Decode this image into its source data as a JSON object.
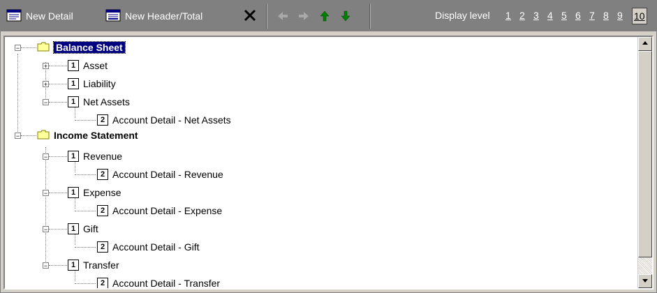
{
  "toolbar": {
    "new_detail": "New Detail",
    "new_header_total": "New Header/Total",
    "display_level_label": "Display level",
    "levels": [
      "1",
      "2",
      "3",
      "4",
      "5",
      "6",
      "7",
      "8",
      "9",
      "10"
    ],
    "active_level": "10"
  },
  "tree": {
    "rows": [
      {
        "label": "Balance Sheet"
      },
      {
        "label": "Asset",
        "level": "1"
      },
      {
        "label": "Liability",
        "level": "1"
      },
      {
        "label": "Net Assets",
        "level": "1"
      },
      {
        "label": "Account Detail - Net Assets",
        "level": "2"
      },
      {
        "label": "Income Statement"
      },
      {
        "label": "Revenue",
        "level": "1"
      },
      {
        "label": "Account Detail - Revenue",
        "level": "2"
      },
      {
        "label": "Expense",
        "level": "1"
      },
      {
        "label": "Account Detail - Expense",
        "level": "2"
      },
      {
        "label": "Gift",
        "level": "1"
      },
      {
        "label": "Account Detail - Gift",
        "level": "2"
      },
      {
        "label": "Transfer",
        "level": "1"
      },
      {
        "label": "Account Detail - Transfer",
        "level": "2"
      }
    ]
  },
  "colors": {
    "toolbar_bg": "#808080",
    "selection_bg": "#000080",
    "move_up_down_arrow": "#008000"
  },
  "icons": [
    "detail-icon",
    "header-total-icon",
    "delete-x-icon",
    "move-left-icon",
    "move-right-icon",
    "move-up-icon",
    "move-down-icon",
    "folder-icon",
    "level-box-icon",
    "expand-icon",
    "collapse-icon"
  ]
}
